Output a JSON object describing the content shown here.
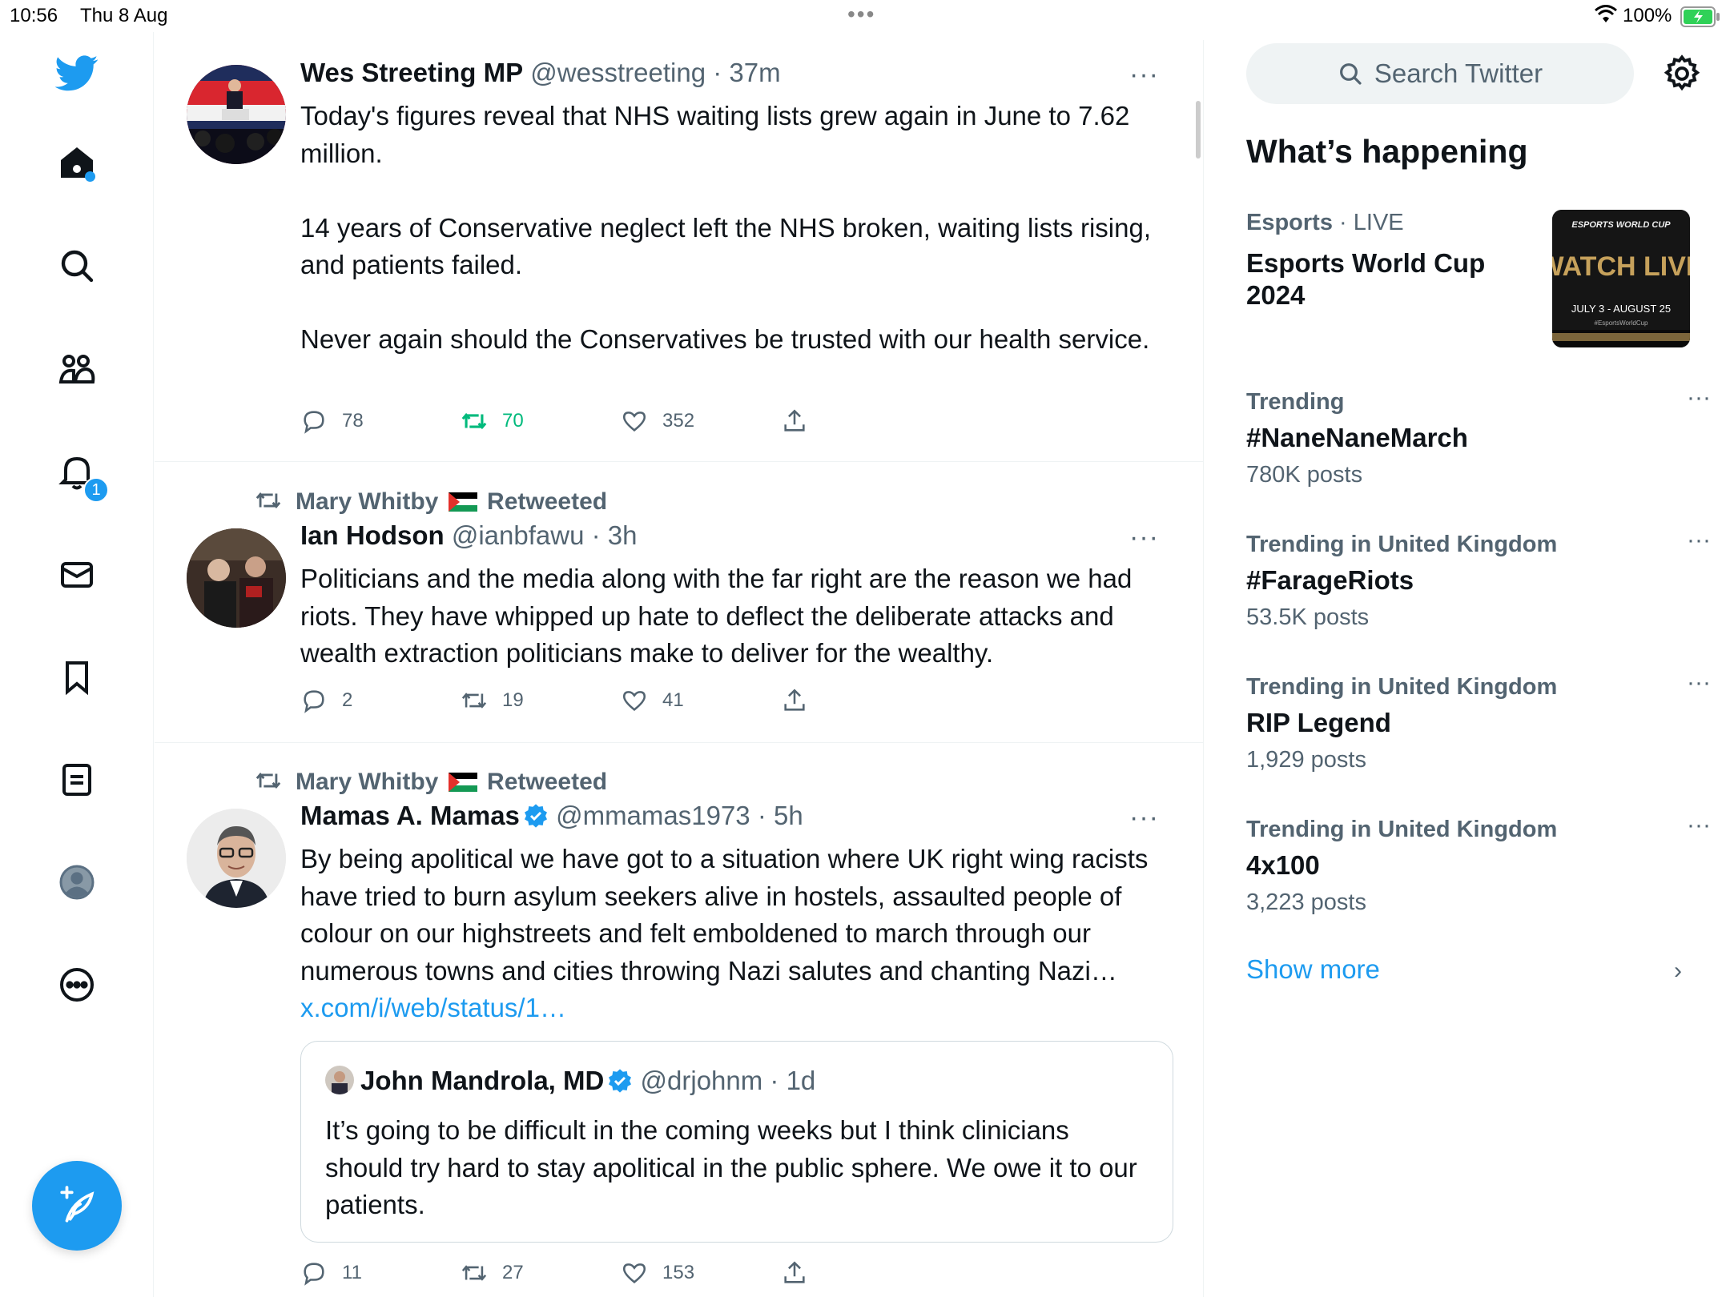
{
  "status_bar": {
    "time": "10:56",
    "date": "Thu 8 Aug",
    "battery": "100%",
    "multitask_icon": "three-dots"
  },
  "nav": {
    "items": [
      {
        "name": "twitter-logo",
        "icon": "bird-icon"
      },
      {
        "name": "home",
        "icon": "home-icon",
        "unread_dot": true
      },
      {
        "name": "explore",
        "icon": "search-icon"
      },
      {
        "name": "communities",
        "icon": "people-icon"
      },
      {
        "name": "notifications",
        "icon": "bell-icon",
        "badge": "1"
      },
      {
        "name": "messages",
        "icon": "mail-icon"
      },
      {
        "name": "bookmarks",
        "icon": "bookmark-icon"
      },
      {
        "name": "lists",
        "icon": "list-icon"
      },
      {
        "name": "profile",
        "icon": "profile-icon"
      },
      {
        "name": "more",
        "icon": "more-circle-icon"
      }
    ],
    "compose_icon": "compose-feather-icon",
    "notification_badge": "1"
  },
  "tweets": [
    {
      "name": "Wes Streeting MP",
      "handle": "@wesstreeting",
      "time": "· 37m",
      "more": "···",
      "body": "Today's figures reveal that NHS waiting lists grew again in June to 7.62 million.\n\n14 years of Conservative neglect left the NHS broken, waiting lists rising, and patients failed.\n\nNever again should the Conservatives be trusted with our health service.",
      "replies": "78",
      "retweets": "70",
      "retweeted_by_me": true,
      "likes": "352"
    },
    {
      "retweeted_by": "Mary Whitby",
      "retweeted_label": "Retweeted",
      "name": "Ian Hodson",
      "handle": "@ianbfawu",
      "time": "· 3h",
      "more": "···",
      "body": "Politicians and the media along with the far right are the reason we had riots. They have whipped up hate to deflect the deliberate attacks and wealth extraction politicians make to deliver for the wealthy.",
      "replies": "2",
      "retweets": "19",
      "likes": "41"
    },
    {
      "retweeted_by": "Mary Whitby",
      "retweeted_label": "Retweeted",
      "name": "Mamas A. Mamas",
      "verified": true,
      "handle": "@mmamas1973",
      "time": "· 5h",
      "more": "···",
      "body": "By being apolitical we have got to a situation where UK right wing racists have tried to burn asylum seekers alive in hostels, assaulted people of colour on our highstreets and felt emboldened to march through our numerous towns and cities throwing Nazi salutes and chanting Nazi… ",
      "link": "x.com/i/web/status/1…",
      "quote": {
        "name": "John Mandrola, MD",
        "verified": true,
        "handle": "@drjohnm",
        "time": "· 1d",
        "body": "It’s going to be difficult in the coming weeks but I think clinicians should try hard to stay apolitical in the public sphere. We owe it to our patients."
      },
      "replies": "11",
      "retweets": "27",
      "likes": "153"
    }
  ],
  "sidebar": {
    "search_placeholder": "Search Twitter",
    "section_title": "What’s happening",
    "esports": {
      "category": "Esports",
      "live": "· LIVE",
      "title": "Esports World Cup 2024",
      "image_text_top": "ESPORTS WORLD CUP",
      "image_text_main": "WATCH LIVE",
      "image_text_dates": "JULY 3 - AUGUST 25",
      "image_text_tag": "#EsportsWorldCup"
    },
    "trends": [
      {
        "meta": "Trending",
        "title": "#NaneNaneMarch",
        "count": "780K posts",
        "more": "···"
      },
      {
        "meta": "Trending in United Kingdom",
        "title": "#FarageRiots",
        "count": "53.5K posts",
        "more": "···"
      },
      {
        "meta": "Trending in United Kingdom",
        "title": "RIP Legend",
        "count": "1,929 posts",
        "more": "···"
      },
      {
        "meta": "Trending in United Kingdom",
        "title": "4x100",
        "count": "3,223 posts",
        "more": "···"
      }
    ],
    "show_more": "Show more"
  },
  "colors": {
    "accent": "#1d9bf0",
    "retweet_green": "#00ba7c",
    "text": "#0f1419",
    "muted": "#536471"
  }
}
